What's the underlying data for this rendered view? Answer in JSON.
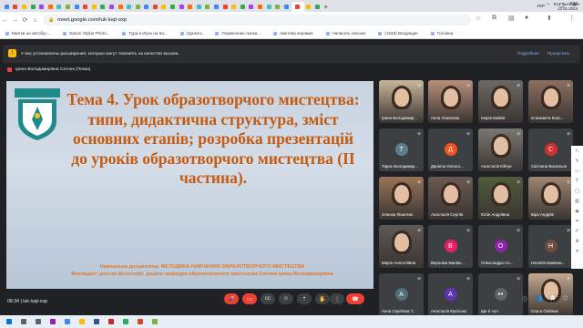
{
  "browser": {
    "url": "meet.google.com/luk-luqt-oxp",
    "tabs_count": 36,
    "bookmarks": [
      "Квитки на автобус...",
      "Epson Stylus Photo...",
      "Тури в Ирэн на Ка...",
      "Удалить",
      "Управление папка...",
      "ометова керамик",
      "Написать письмо",
      "(1048) Входящие",
      "Головна"
    ],
    "all_bookmarks": "Все закладки"
  },
  "meet": {
    "extension_notice": "У вас установлены расширения, которые могут повлиять на качество вызова.",
    "extension_details": "Подробнее",
    "extension_skip": "Пропустить",
    "presenter_label": "Ірина Володимирівна Ситник (Показ)",
    "meeting_time": "08:34",
    "meeting_code": "luk-luqt-oxp"
  },
  "slide": {
    "title": "Тема 4. Урок образотворчого мистецтва: типи, дидактична структура, зміст основних етапів; розробка презентацій до уроків образотворчого мистецтва (ІІ частина).",
    "discipline": "Навчальна дисципліна: МЕТОДИКА НАВЧАННЯ ОБРАЗОТВОРЧОГО МИСТЕЦТВА",
    "lecturer": "Викладач: доктор філософії, доцент кафедри образотворчого мистецтва Ситник Ірина Володимирівна"
  },
  "participants": [
    {
      "name": "Ірина Володимир...",
      "initial": "",
      "kind": "video",
      "tone": "#c9b79c"
    },
    {
      "name": "Анна Усманова",
      "initial": "",
      "kind": "video",
      "tone": "#b98f7a"
    },
    {
      "name": "Марія Байпів",
      "initial": "",
      "kind": "video",
      "tone": "#6d6a66"
    },
    {
      "name": "Єлизавета Коль...",
      "initial": "",
      "kind": "video",
      "tone": "#8c6f5e"
    },
    {
      "name": "Тарас Володимир...",
      "initial": "Т",
      "kind": "avatar",
      "color": "#607d8b"
    },
    {
      "name": "Даніела Олексо...",
      "initial": "Д",
      "kind": "avatar",
      "color": "#f4511e"
    },
    {
      "name": "Анастасія Кібчук",
      "initial": "",
      "kind": "video",
      "tone": "#7a7773"
    },
    {
      "name": "Світлана Васильєв",
      "initial": "С",
      "kind": "avatar",
      "color": "#d32f2f"
    },
    {
      "name": "Оленка Ліанетик",
      "initial": "",
      "kind": "video",
      "tone": "#9a7458"
    },
    {
      "name": "Анастасія Сергіїв",
      "initial": "",
      "kind": "video",
      "tone": "#6b5a52"
    },
    {
      "name": "Юлія Андріївна",
      "initial": "",
      "kind": "video",
      "tone": "#4f5b3a"
    },
    {
      "name": "Віра Андріїв",
      "initial": "",
      "kind": "video",
      "tone": "#a08574"
    },
    {
      "name": "Марія Анатоліївна",
      "initial": "",
      "kind": "video",
      "tone": "#5e5954"
    },
    {
      "name": "Вероніка Іванівн...",
      "initial": "В",
      "kind": "avatar",
      "color": "#e91e63"
    },
    {
      "name": "Олександра Се...",
      "initial": "О",
      "kind": "avatar",
      "color": "#8e24aa"
    },
    {
      "name": "Наталія Іванівна...",
      "initial": "Н",
      "kind": "avatar",
      "color": "#6d4c41"
    },
    {
      "name": "Анна Сергіївна Т...",
      "initial": "А",
      "kind": "avatar",
      "color": "#546e7a"
    },
    {
      "name": "Анастасія Мусієнко",
      "initial": "А",
      "kind": "avatar",
      "color": "#5e35b1"
    },
    {
      "name": "Ще 6 чол.",
      "initial": "",
      "kind": "more",
      "color": "#3c4043"
    },
    {
      "name": "Ольга Олійник",
      "initial": "",
      "kind": "video",
      "tone": "#c6a891"
    }
  ],
  "taskbar": {
    "lang": "УКР",
    "time": "8:34",
    "date": "12.01.2024"
  }
}
